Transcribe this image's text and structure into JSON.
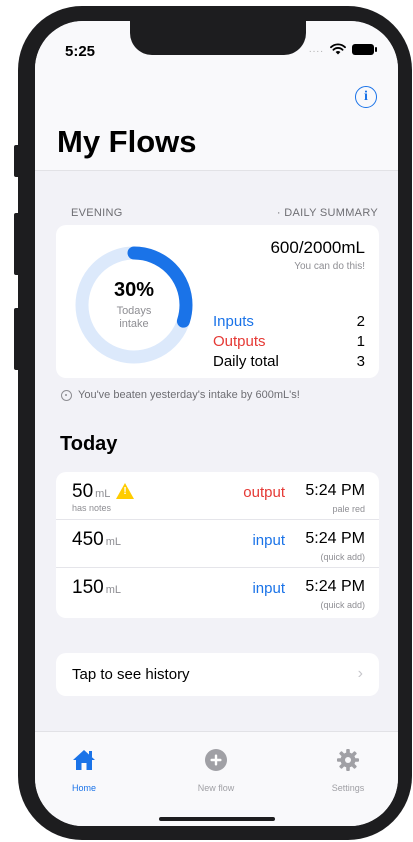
{
  "status": {
    "time": "5:25",
    "signal": "...."
  },
  "header": {
    "title": "My Flows",
    "info_icon": "info-icon",
    "info_glyph": "i"
  },
  "summary": {
    "period_label": "EVENING",
    "summary_label": "· DAILY SUMMARY",
    "percent": "30%",
    "ring_label_line1": "Todays",
    "ring_label_line2": "intake",
    "progress": 0.3,
    "total": "600/2000mL",
    "encouragement": "You can do this!",
    "rows": [
      {
        "label": "Inputs",
        "value": "2",
        "color": "#1a73e8"
      },
      {
        "label": "Outputs",
        "value": "1",
        "color": "#e53935"
      },
      {
        "label": "Daily total",
        "value": "3",
        "color": "#000000"
      }
    ]
  },
  "beaten_message": "You've beaten yesterday's intake by 600mL's!",
  "today": {
    "title": "Today",
    "flows": [
      {
        "amount": "50",
        "unit": "mL",
        "note": "has notes",
        "has_warning": true,
        "type": "output",
        "type_color": "#e53935",
        "time": "5:24 PM",
        "sub": "pale red"
      },
      {
        "amount": "450",
        "unit": "mL",
        "note": "",
        "has_warning": false,
        "type": "input",
        "type_color": "#1a73e8",
        "time": "5:24 PM",
        "sub": "(quick add)"
      },
      {
        "amount": "150",
        "unit": "mL",
        "note": "",
        "has_warning": false,
        "type": "input",
        "type_color": "#1a73e8",
        "time": "5:24 PM",
        "sub": "(quick add)"
      }
    ]
  },
  "history": {
    "label": "Tap to see history",
    "chevron": "›"
  },
  "tabs": [
    {
      "label": "Home",
      "icon": "home-icon",
      "active": true
    },
    {
      "label": "New flow",
      "icon": "plus-circle-icon",
      "active": false
    },
    {
      "label": "Settings",
      "icon": "gear-icon",
      "active": false
    }
  ],
  "colors": {
    "accent": "#1a73e8",
    "output": "#e53935",
    "ring_track": "#dce9fb",
    "inactive": "#a0a0a5"
  }
}
